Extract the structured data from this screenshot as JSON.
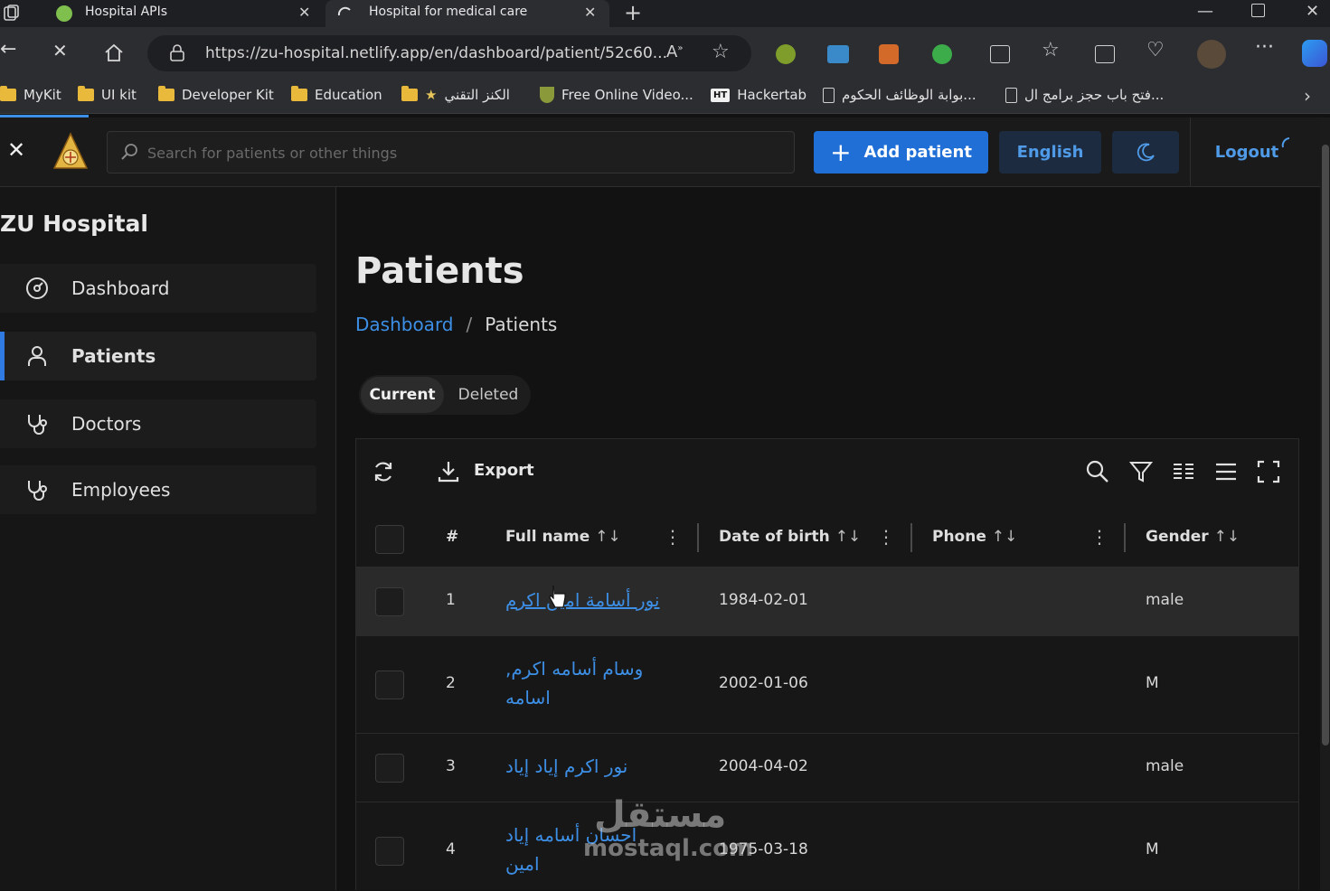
{
  "browser": {
    "tabs": [
      {
        "title": "Hospital APIs",
        "active": false
      },
      {
        "title": "Hospital for medical care",
        "active": true
      }
    ],
    "new_tab_glyph": "+",
    "address": "https://zu-hospital.netlify.app/en/dashboard/patient/52c60...",
    "bookmarks": [
      {
        "label": "MyKit",
        "icon": "folder-icon"
      },
      {
        "label": "UI kit",
        "icon": "folder-icon"
      },
      {
        "label": "Developer Kit",
        "icon": "folder-icon"
      },
      {
        "label": "Education",
        "icon": "folder-icon"
      },
      {
        "label": "الكنز التقني",
        "icon": "folder-icon"
      },
      {
        "label": "Free Online Video...",
        "icon": "shield-icon"
      },
      {
        "label": "Hackertab",
        "icon": "ht-icon",
        "badge": "HT"
      },
      {
        "label": "بوابة الوظائف الحكوم...",
        "icon": "page-icon"
      },
      {
        "label": "فتح باب حجز برامج ال...",
        "icon": "page-icon"
      }
    ],
    "colors": {
      "accent": "#3d8fe6",
      "folder": "#e8b93a"
    }
  },
  "header": {
    "search_placeholder": "Search for patients or other things",
    "add_patient_label": "Add patient",
    "language_label": "English",
    "logout_label": "Logout",
    "colors": {
      "primary": "#1f6fd6",
      "secondary": "#1c2b3f"
    }
  },
  "sidebar": {
    "title": "ZU Hospital",
    "items": [
      {
        "label": "Dashboard",
        "icon": "dashboard-icon",
        "active": false
      },
      {
        "label": "Patients",
        "icon": "user-icon",
        "active": true
      },
      {
        "label": "Doctors",
        "icon": "stethoscope-icon",
        "active": false
      },
      {
        "label": "Employees",
        "icon": "stethoscope-icon",
        "active": false
      }
    ]
  },
  "main": {
    "title": "Patients",
    "breadcrumb": {
      "link": "Dashboard",
      "separator": "/",
      "current": "Patients"
    },
    "tabs": [
      {
        "label": "Current",
        "active": true
      },
      {
        "label": "Deleted",
        "active": false
      }
    ],
    "toolbar": {
      "export_label": "Export"
    },
    "table": {
      "columns": [
        "#",
        "Full name",
        "Date of birth",
        "Phone",
        "Gender"
      ],
      "sort_glyph": "↑↓",
      "rows": [
        {
          "index": "1",
          "name": "نور أسامة امين اكرم",
          "dob": "1984-02-01",
          "phone": "",
          "gender": "male"
        },
        {
          "index": "2",
          "name": "وسام أسامه اكرم, اسامه",
          "dob": "2002-01-06",
          "phone": "",
          "gender": "M"
        },
        {
          "index": "3",
          "name": "نور اكرم إياد إياد",
          "dob": "2004-04-02",
          "phone": "",
          "gender": "male"
        },
        {
          "index": "4",
          "name": "احسان أسامه إياد امين",
          "dob": "1975-03-18",
          "phone": "",
          "gender": "M"
        }
      ]
    }
  },
  "watermark": {
    "arabic": "مستقل",
    "latin": "mostaql.com"
  }
}
